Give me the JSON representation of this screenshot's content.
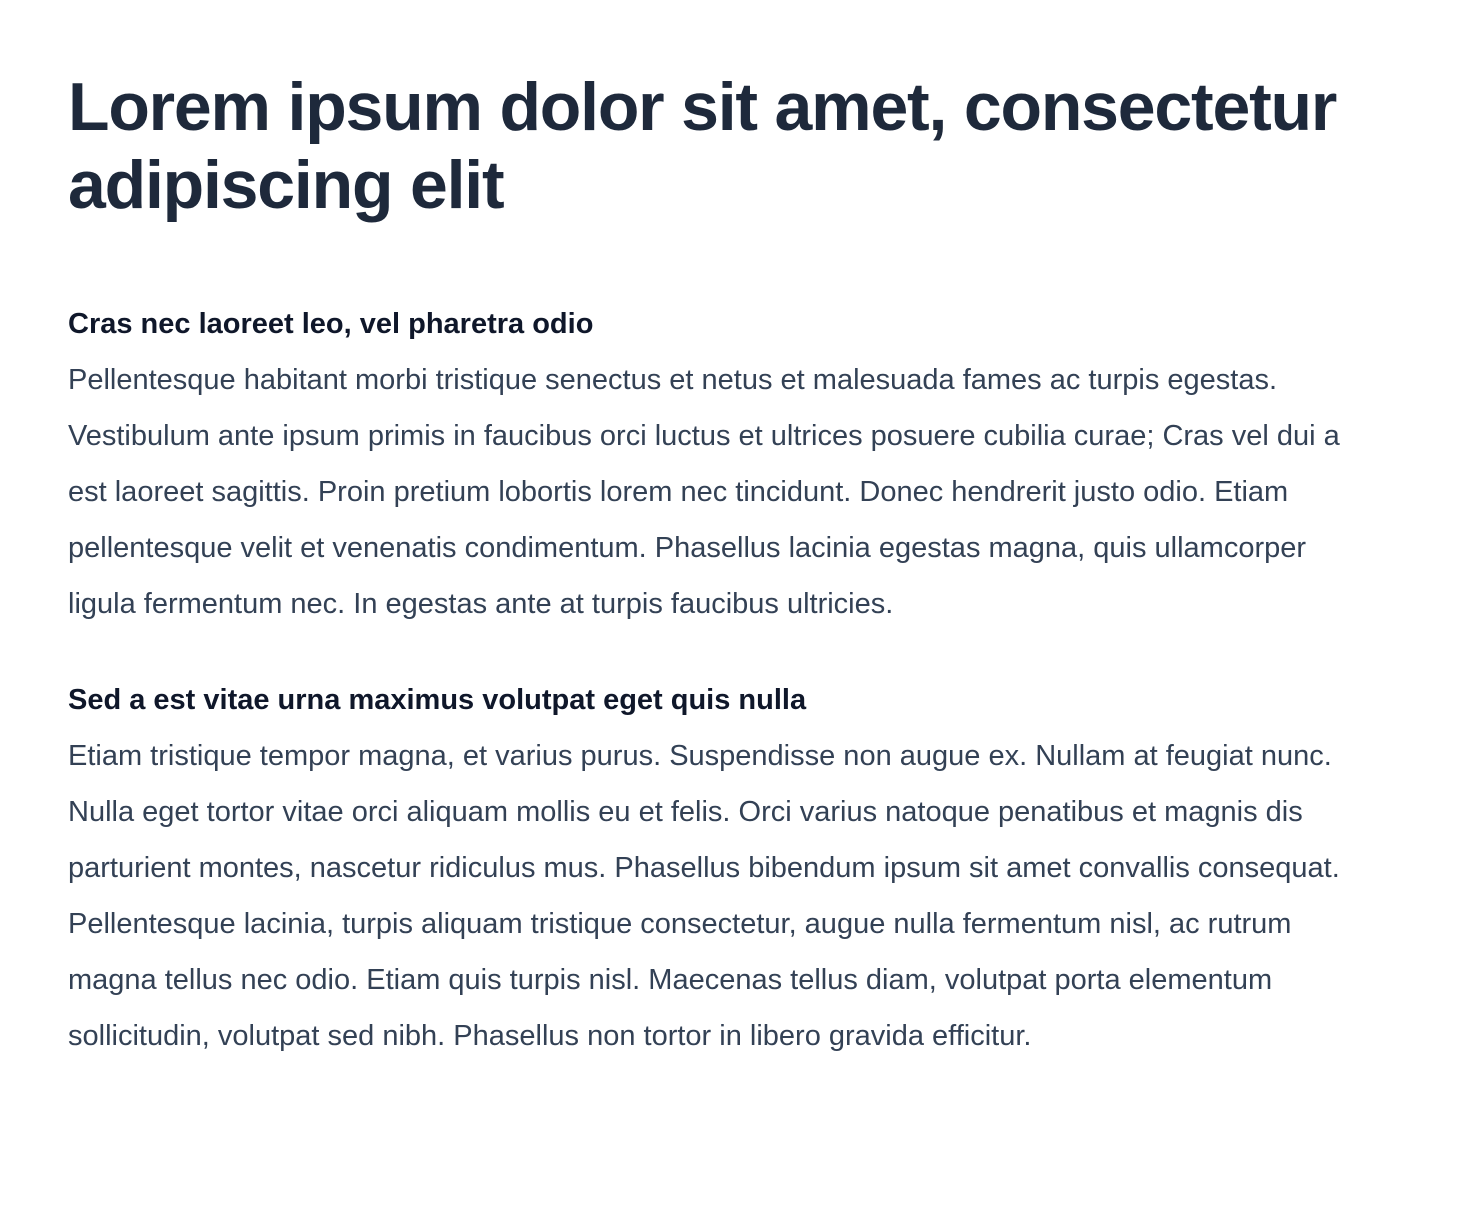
{
  "article": {
    "title": "Lorem ipsum dolor sit amet, consectetur adipiscing elit",
    "sections": [
      {
        "heading": "Cras nec laoreet leo, vel pharetra odio",
        "body": "Pellentesque habitant morbi tristique senectus et netus et malesuada fames ac turpis egestas. Vestibulum ante ipsum primis in faucibus orci luctus et ultrices posuere cubilia curae; Cras vel dui a est laoreet sagittis. Proin pretium lobortis lorem nec tincidunt. Donec hendrerit justo odio. Etiam pellentesque velit et venenatis condimentum. Phasellus lacinia egestas magna, quis ullamcorper ligula fermentum nec. In egestas ante at turpis faucibus ultricies."
      },
      {
        "heading": "Sed a est vitae urna maximus volutpat eget quis nulla",
        "body": "Etiam tristique tempor magna, et varius purus. Suspendisse non augue ex. Nullam at feugiat nunc. Nulla eget tortor vitae orci aliquam mollis eu et felis. Orci varius natoque penatibus et magnis dis parturient montes, nascetur ridiculus mus. Phasellus bibendum ipsum sit amet convallis consequat. Pellentesque lacinia, turpis aliquam tristique consectetur, augue nulla fermentum nisl, ac rutrum magna tellus nec odio. Etiam quis turpis nisl. Maecenas tellus diam, volutpat porta elementum sollicitudin, volutpat sed nibh. Phasellus non tortor in libero gravida efficitur."
      }
    ]
  },
  "colors": {
    "title": "#1e293b",
    "heading": "#0f172a",
    "body": "#334155",
    "background": "#ffffff"
  }
}
